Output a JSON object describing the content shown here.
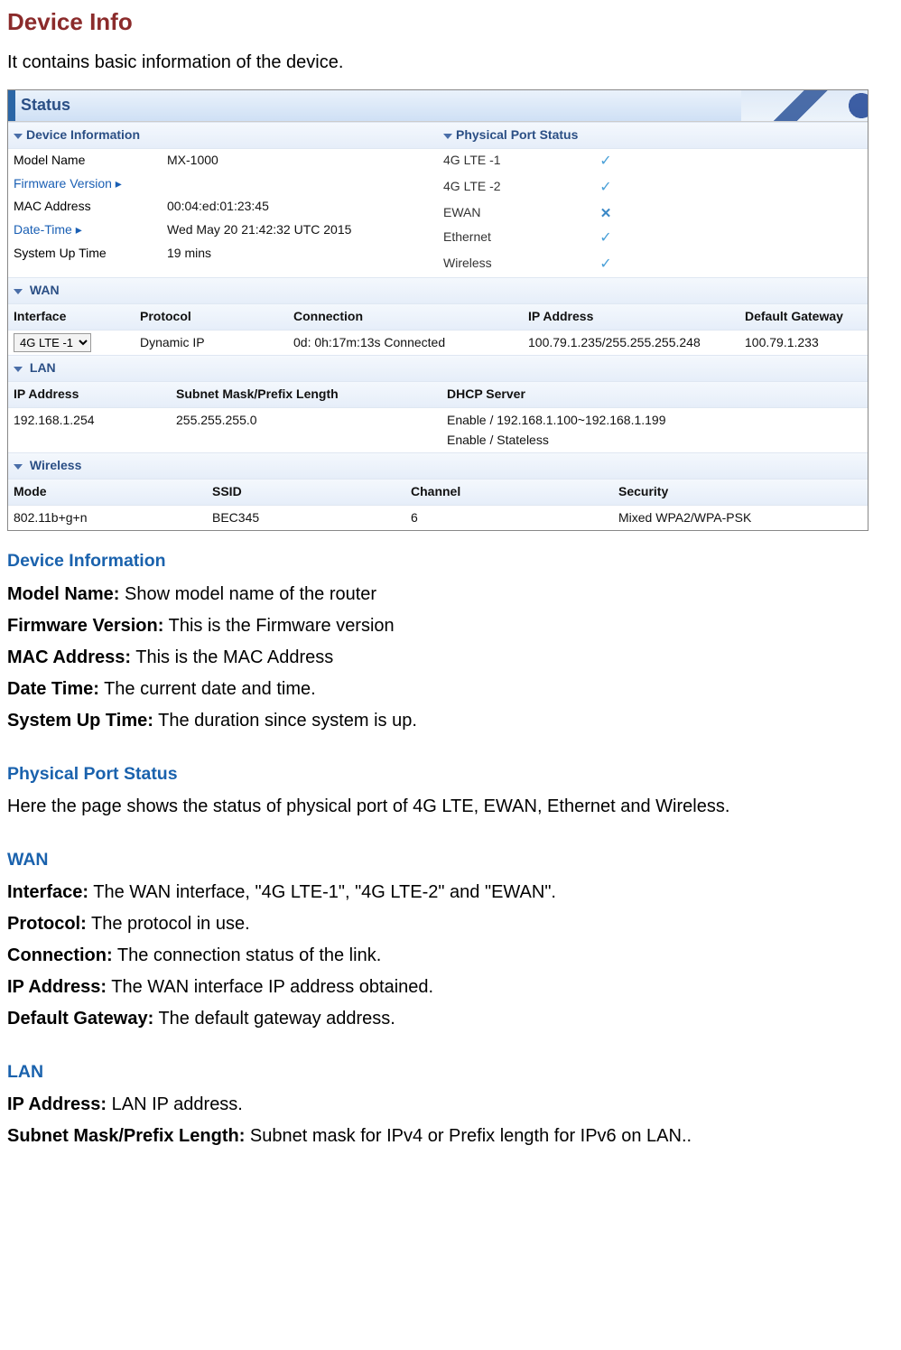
{
  "page": {
    "title": "Device Info",
    "intro": "It contains basic information of the device."
  },
  "status": {
    "bar_label": "Status",
    "device_info": {
      "header": "Device Information",
      "rows": [
        {
          "label": "Model Name",
          "link": false,
          "caret": false,
          "value": "MX-1000"
        },
        {
          "label": "Firmware Version",
          "link": true,
          "caret": true,
          "value": ""
        },
        {
          "label": "MAC Address",
          "link": false,
          "caret": false,
          "value": "00:04:ed:01:23:45"
        },
        {
          "label": "Date-Time",
          "link": true,
          "caret": true,
          "value": "Wed May 20 21:42:32 UTC 2015"
        },
        {
          "label": "System Up Time",
          "link": false,
          "caret": false,
          "value": "19 mins"
        }
      ]
    },
    "ports": {
      "header": "Physical Port Status",
      "rows": [
        {
          "label": "4G LTE -1",
          "mark": "check"
        },
        {
          "label": "4G LTE -2",
          "mark": "check"
        },
        {
          "label": "EWAN",
          "mark": "cross"
        },
        {
          "label": "Ethernet",
          "mark": "check"
        },
        {
          "label": "Wireless",
          "mark": "check"
        }
      ]
    },
    "wan": {
      "header": "WAN",
      "cols": {
        "c1": "Interface",
        "c2": "Protocol",
        "c3": "Connection",
        "c4": "IP Address",
        "c5": "Default Gateway"
      },
      "row": {
        "interface_selected": "4G LTE -1",
        "protocol": "Dynamic IP",
        "connection": "0d: 0h:17m:13s Connected",
        "ip": "100.79.1.235/255.255.255.248",
        "gateway": "100.79.1.233"
      }
    },
    "lan": {
      "header": "LAN",
      "cols": {
        "c1": "IP Address",
        "c2": "Subnet Mask/Prefix Length",
        "c3": "DHCP Server"
      },
      "row": {
        "ip": "192.168.1.254",
        "mask": "255.255.255.0",
        "dhcp_line1": "Enable / 192.168.1.100~192.168.1.199",
        "dhcp_line2": "Enable / Stateless"
      }
    },
    "wireless": {
      "header": "Wireless",
      "cols": {
        "c1": "Mode",
        "c2": "SSID",
        "c3": "Channel",
        "c4": "Security"
      },
      "row": {
        "mode": "802.11b+g+n",
        "ssid": "BEC345",
        "channel": "6",
        "security": "Mixed WPA2/WPA-PSK"
      }
    }
  },
  "doc": {
    "device_info": {
      "title": "Device Information",
      "items": [
        {
          "label": "Model Name:",
          "text": " Show model name of the router"
        },
        {
          "label": "Firmware Version:",
          "text": " This is the Firmware version"
        },
        {
          "label": "MAC Address:",
          "text": " This is the MAC Address"
        },
        {
          "label": "Date Time:",
          "text": " The current date and  time."
        },
        {
          "label": "System Up Time:",
          "text": " The duration since system is up."
        }
      ]
    },
    "ports": {
      "title": "Physical Port Status",
      "body": "Here the page shows the status of physical port of 4G LTE, EWAN, Ethernet and Wireless."
    },
    "wan": {
      "title": "WAN",
      "items": [
        {
          "label": "Interface:",
          "text": " The WAN interface, \"4G LTE-1\", \"4G LTE-2\" and \"EWAN\"."
        },
        {
          "label": "Protocol:",
          "text": " The protocol in use."
        },
        {
          "label": "Connection:",
          "text": " The connection status of the link."
        },
        {
          "label": "IP Address:",
          "text": " The WAN interface IP address obtained."
        },
        {
          "label": "Default Gateway:",
          "text": " The default gateway address."
        }
      ]
    },
    "lan": {
      "title": "LAN",
      "items": [
        {
          "label": "IP Address:",
          "text": " LAN IP address."
        },
        {
          "label": "Subnet Mask/Prefix Length:",
          "text": " Subnet mask for IPv4 or Prefix length for IPv6 on LAN.."
        }
      ]
    }
  }
}
